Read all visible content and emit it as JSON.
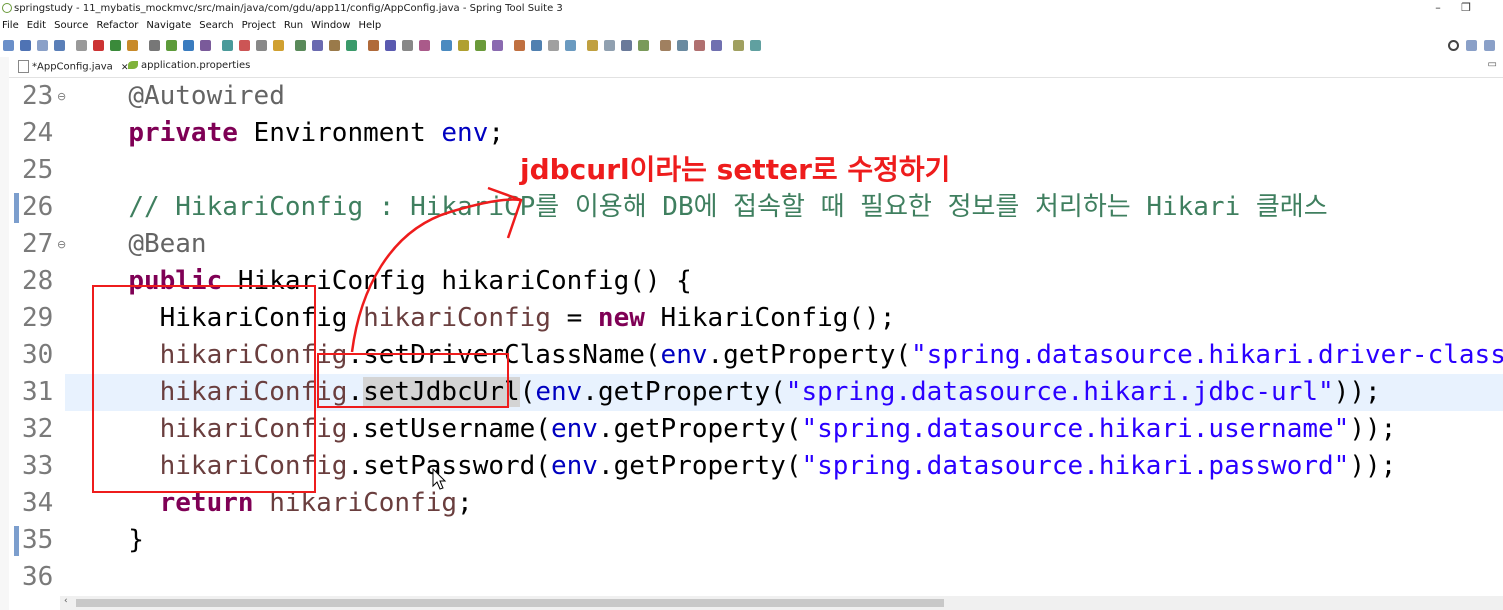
{
  "window": {
    "title": "springstudy - 11_mybatis_mockmvc/src/main/java/com/gdu/app11/config/AppConfig.java - Spring Tool Suite 3",
    "minimize": "–",
    "restore": "❐"
  },
  "menu": [
    "File",
    "Edit",
    "Source",
    "Refactor",
    "Navigate",
    "Search",
    "Project",
    "Run",
    "Window",
    "Help"
  ],
  "tabs": [
    {
      "label": "*AppConfig.java",
      "close": "✕"
    },
    {
      "label": "application.properties"
    }
  ],
  "editor": {
    "lines": [
      {
        "num": "23",
        "fold": "⊖",
        "segs": [
          {
            "t": "  "
          },
          {
            "t": "@Autowired",
            "c": "ann"
          }
        ]
      },
      {
        "num": "24",
        "segs": [
          {
            "t": "  "
          },
          {
            "t": "private",
            "c": "kw"
          },
          {
            "t": " Environment "
          },
          {
            "t": "env",
            "c": "field"
          },
          {
            "t": ";"
          }
        ]
      },
      {
        "num": "25",
        "segs": []
      },
      {
        "num": "26",
        "mark": true,
        "segs": [
          {
            "t": "  "
          },
          {
            "t": "// HikariConfig : HikariCP를 이용해 DB에 접속할 때 필요한 정보를 처리하는 Hikari 클래스",
            "c": "comment"
          }
        ]
      },
      {
        "num": "27",
        "fold": "⊖",
        "segs": [
          {
            "t": "  "
          },
          {
            "t": "@Bean",
            "c": "ann"
          }
        ]
      },
      {
        "num": "28",
        "segs": [
          {
            "t": "  "
          },
          {
            "t": "public",
            "c": "kw"
          },
          {
            "t": " HikariConfig hikariConfig() {"
          }
        ]
      },
      {
        "num": "29",
        "segs": [
          {
            "t": "    HikariConfig "
          },
          {
            "t": "hikariConfig",
            "c": "local"
          },
          {
            "t": " = "
          },
          {
            "t": "new",
            "c": "kw"
          },
          {
            "t": " HikariConfig();"
          }
        ]
      },
      {
        "num": "30",
        "segs": [
          {
            "t": "    "
          },
          {
            "t": "hikariConfig",
            "c": "local"
          },
          {
            "t": ".setDriverClassName("
          },
          {
            "t": "env",
            "c": "field"
          },
          {
            "t": ".getProperty("
          },
          {
            "t": "\"spring.datasource.hikari.driver-class",
            "c": "str"
          }
        ]
      },
      {
        "num": "31",
        "current": true,
        "segs": [
          {
            "t": "    "
          },
          {
            "t": "hikariConfig",
            "c": "local"
          },
          {
            "t": "."
          },
          {
            "t": "setJdbcUrl",
            "c": "occ"
          },
          {
            "t": "("
          },
          {
            "t": "env",
            "c": "field"
          },
          {
            "t": ".getProperty("
          },
          {
            "t": "\"spring.datasource.hikari.jdbc-url\"",
            "c": "str"
          },
          {
            "t": "));"
          }
        ]
      },
      {
        "num": "32",
        "segs": [
          {
            "t": "    "
          },
          {
            "t": "hikariConfig",
            "c": "local"
          },
          {
            "t": ".setUsername("
          },
          {
            "t": "env",
            "c": "field"
          },
          {
            "t": ".getProperty("
          },
          {
            "t": "\"spring.datasource.hikari.username\"",
            "c": "str"
          },
          {
            "t": "));"
          }
        ]
      },
      {
        "num": "33",
        "segs": [
          {
            "t": "    "
          },
          {
            "t": "hikariConfig",
            "c": "local"
          },
          {
            "t": ".setPassword("
          },
          {
            "t": "env",
            "c": "field"
          },
          {
            "t": ".getProperty("
          },
          {
            "t": "\"spring.datasource.hikari.password\"",
            "c": "str"
          },
          {
            "t": "));"
          }
        ]
      },
      {
        "num": "34",
        "segs": [
          {
            "t": "    "
          },
          {
            "t": "return",
            "c": "kw"
          },
          {
            "t": " "
          },
          {
            "t": "hikariConfig",
            "c": "local"
          },
          {
            "t": ";"
          }
        ]
      },
      {
        "num": "35",
        "mark": true,
        "segs": [
          {
            "t": "  }"
          }
        ]
      },
      {
        "num": "36",
        "segs": []
      }
    ]
  },
  "annotation": {
    "text": "jdbcurl이라는 setter로 수정하기",
    "color": "#ee1c1c"
  },
  "scroll": {
    "left_arrow": "‹",
    "right_arrow": "›"
  }
}
